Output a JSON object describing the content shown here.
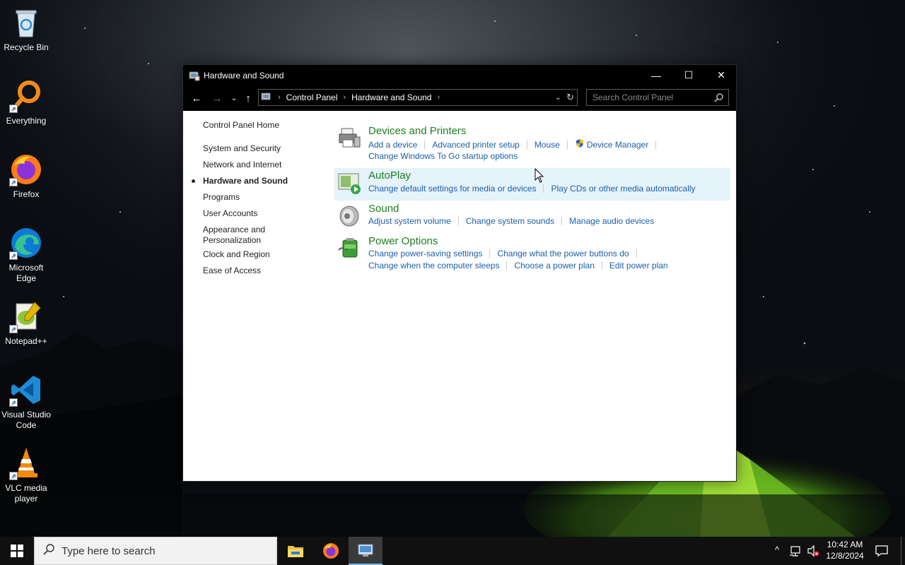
{
  "desktop": {
    "icons": [
      {
        "label": "Recycle Bin"
      },
      {
        "label": "Everything"
      },
      {
        "label": "Firefox"
      },
      {
        "label": "Microsoft Edge"
      },
      {
        "label": "Notepad++"
      },
      {
        "label": "Visual Studio Code"
      },
      {
        "label": "VLC media player"
      }
    ]
  },
  "window": {
    "title": "Hardware and Sound",
    "controls": {
      "minimize": "—",
      "maximize": "☐",
      "close": "✕"
    },
    "address": {
      "crumbs": [
        "Control Panel",
        "Hardware and Sound"
      ],
      "search_placeholder": "Search Control Panel"
    },
    "left_nav": {
      "home": "Control Panel Home",
      "items": [
        "System and Security",
        "Network and Internet",
        "Hardware and Sound",
        "Programs",
        "User Accounts",
        "Appearance and\nPersonalization",
        "Clock and Region",
        "Ease of Access"
      ],
      "active_index": 2
    },
    "categories": [
      {
        "title": "Devices and Printers",
        "icon": "printer-icon",
        "links_row1": [
          "Add a device",
          "Advanced printer setup",
          "Mouse",
          "Device Manager"
        ],
        "links_row2": [
          "Change Windows To Go startup options"
        ]
      },
      {
        "title": "AutoPlay",
        "icon": "autoplay-icon",
        "links_row1": [
          "Change default settings for media or devices",
          "Play CDs or other media automatically"
        ]
      },
      {
        "title": "Sound",
        "icon": "speaker-icon",
        "links_row1": [
          "Adjust system volume",
          "Change system sounds",
          "Manage audio devices"
        ]
      },
      {
        "title": "Power Options",
        "icon": "battery-icon",
        "links_row1": [
          "Change power-saving settings",
          "Change what the power buttons do"
        ],
        "links_row2": [
          "Change when the computer sleeps",
          "Choose a power plan",
          "Edit power plan"
        ]
      }
    ]
  },
  "taskbar": {
    "search_placeholder": "Type here to search",
    "time": "10:42 AM",
    "date": "12/8/2024"
  },
  "colors": {
    "category_title": "#1e7e1e",
    "link": "#1a5fa8",
    "hover_row": "#e5f3fb"
  }
}
